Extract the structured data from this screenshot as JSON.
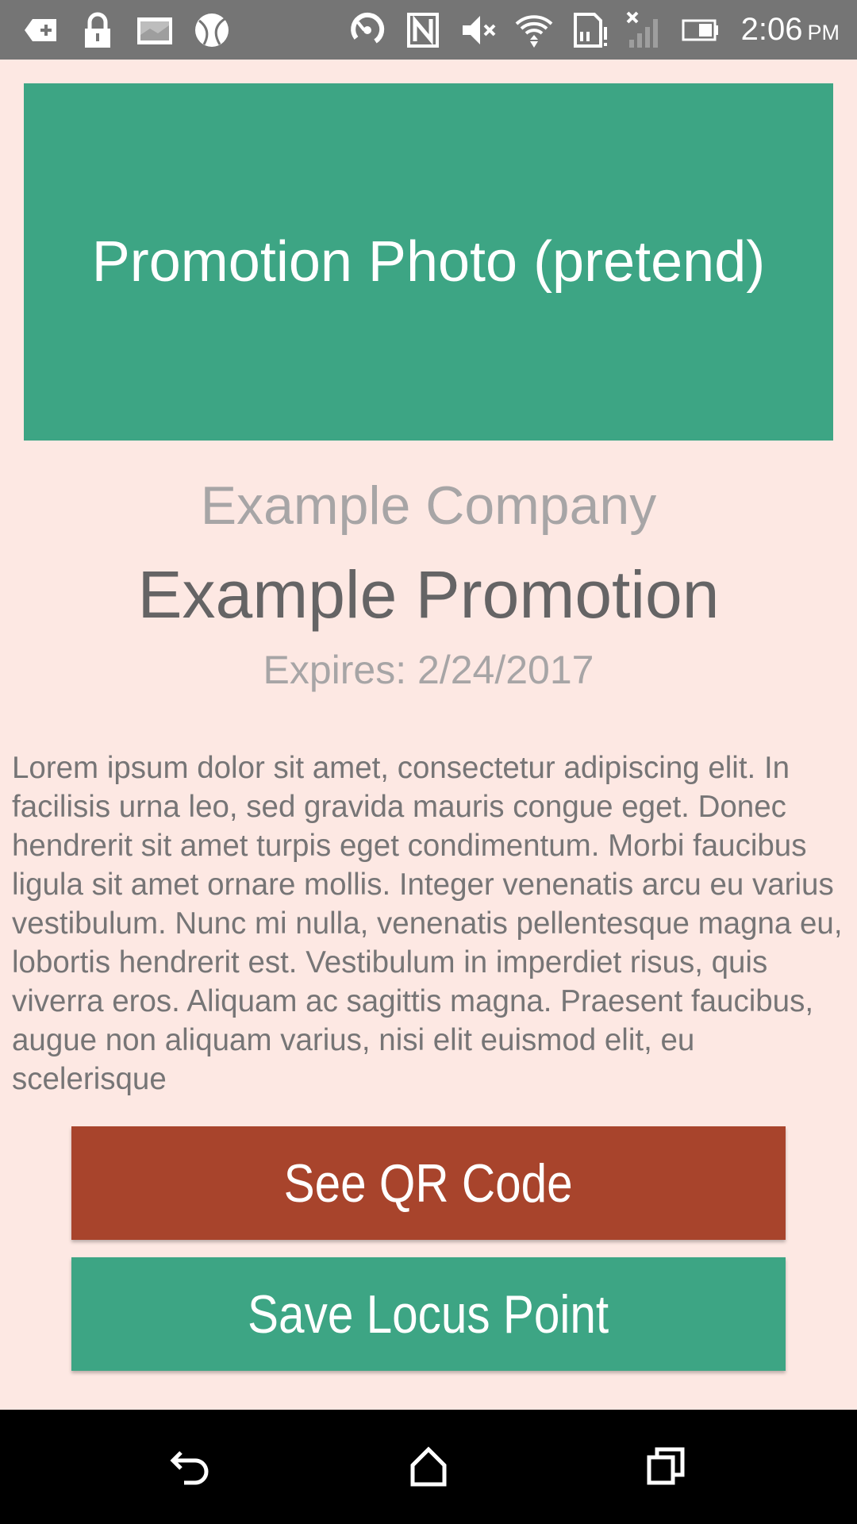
{
  "status_bar": {
    "time": "2:06",
    "ampm": "PM",
    "icons": [
      "add-notification-icon",
      "lock-icon",
      "image-icon",
      "ball-icon",
      "sync-icon",
      "nfc-icon",
      "mute-icon",
      "wifi-icon",
      "sd-alert-icon",
      "no-signal-icon",
      "battery-icon"
    ]
  },
  "promo": {
    "photo_label": "Promotion Photo (pretend)",
    "company": "Example Company",
    "title": "Example Promotion",
    "expires": "Expires: 2/24/2017",
    "description": "Lorem ipsum dolor sit amet, consectetur adipiscing elit. In facilisis urna leo, sed gravida mauris congue eget. Donec hendrerit sit amet turpis eget condimentum. Morbi faucibus ligula sit amet ornare mollis. Integer venenatis arcu eu varius vestibulum. Nunc mi nulla, venenatis pellentesque magna eu, lobortis hendrerit est. Vestibulum in imperdiet risus, quis viverra eros. Aliquam ac sagittis magna. Praesent faucibus, augue non aliquam varius, nisi elit euismod elit, eu scelerisque"
  },
  "actions": {
    "qr_label": "See QR Code",
    "save_label": "Save Locus Point"
  },
  "colors": {
    "background": "#fde8e3",
    "green": "#3da584",
    "red": "#a8442c",
    "status_bar": "#757575"
  },
  "nav_bar": {
    "icons": [
      "back-icon",
      "home-icon",
      "recents-icon"
    ]
  }
}
